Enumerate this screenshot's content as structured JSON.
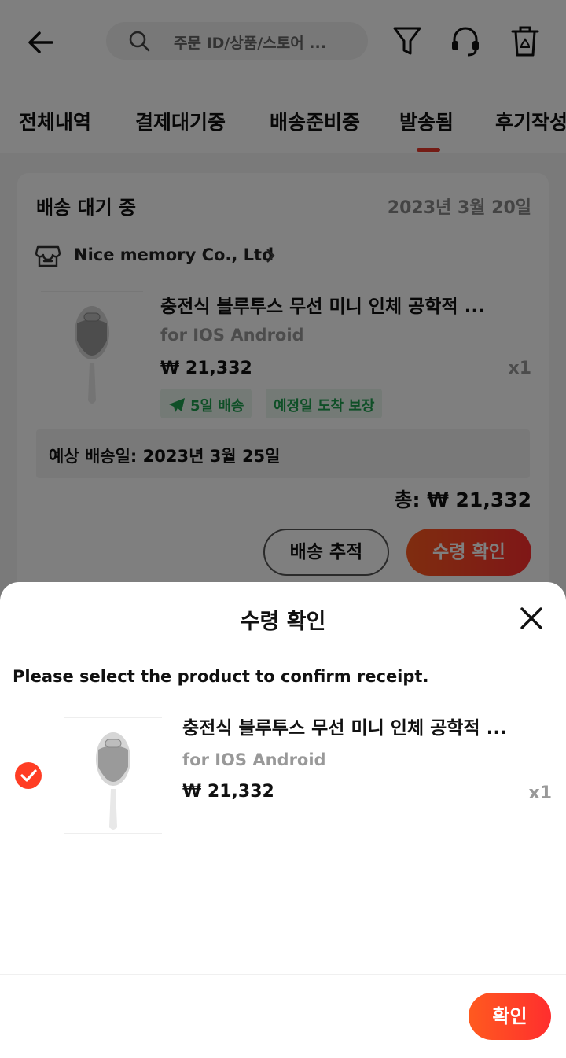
{
  "header": {
    "search_placeholder": "주문 ID/상품/스토어 ...",
    "icons": [
      "back-arrow-icon",
      "search-icon",
      "filter-icon",
      "headset-icon",
      "recycle-bin-icon"
    ]
  },
  "tabs": [
    {
      "label": "전체내역",
      "active": false
    },
    {
      "label": "결제대기중",
      "active": false
    },
    {
      "label": "배송준비중",
      "active": false
    },
    {
      "label": "발송됨",
      "active": true
    },
    {
      "label": "후기작성",
      "active": false
    }
  ],
  "order": {
    "status": "배송 대기 중",
    "date": "2023년 3월 20일",
    "store_name": "Nice memory Co., Ltd",
    "product": {
      "title": "충전식 블루투스 무선 미니 인체 공학적 ...",
      "variant": "for IOS Android",
      "price": "₩ 21,332",
      "quantity": "x1"
    },
    "badges": [
      "5일 배송",
      "예정일 도착 보장"
    ],
    "eta": "예상 배송일: 2023년 3월 25일",
    "total": "총: ₩ 21,332",
    "track_button": "배송 추적",
    "confirm_button": "수령 확인"
  },
  "sheet": {
    "title": "수령 확인",
    "instruction": "Please select the product to confirm receipt.",
    "product": {
      "title": "충전식 블루투스 무선 미니 인체 공학적 ...",
      "variant": "for IOS Android",
      "price": "₩ 21,332",
      "quantity": "x1",
      "selected": true
    },
    "confirm_button": "확인"
  },
  "colors": {
    "accent": "#ff3d24",
    "badge_green": "#1e9f4f",
    "overlay": "rgba(0,0,0,0.5)"
  }
}
